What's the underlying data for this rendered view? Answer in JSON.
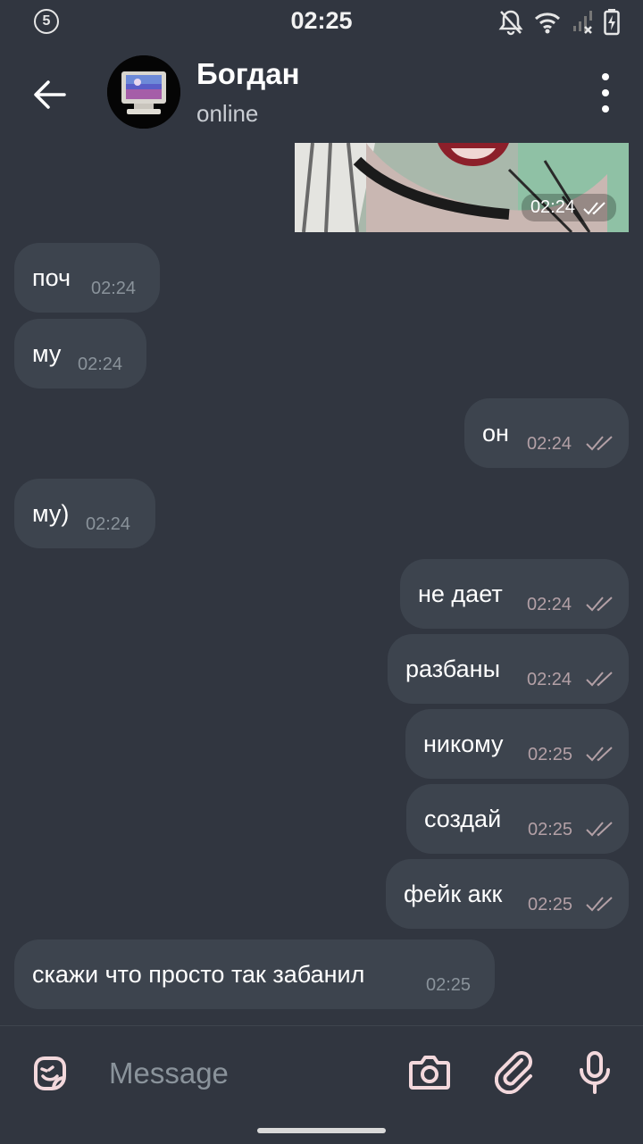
{
  "status_bar": {
    "time": "02:25",
    "notification_count": "5",
    "icons": [
      "notifications-off-icon",
      "wifi-icon",
      "signal-no-service-icon",
      "battery-charging-icon"
    ]
  },
  "header": {
    "contact_name": "Богдан",
    "contact_status": "online",
    "icons": [
      "back-arrow-icon",
      "avatar-retro-computer",
      "more-vert-icon"
    ]
  },
  "messages": [
    {
      "direction": "out",
      "type": "photo",
      "time": "02:24",
      "read": true
    },
    {
      "direction": "in",
      "text": "поч",
      "time": "02:24"
    },
    {
      "direction": "in",
      "text": "му",
      "time": "02:24"
    },
    {
      "direction": "out",
      "text": "он",
      "time": "02:24",
      "read": true
    },
    {
      "direction": "in",
      "text": "му)",
      "time": "02:24"
    },
    {
      "direction": "out",
      "text": "не дает",
      "time": "02:24",
      "read": true
    },
    {
      "direction": "out",
      "text": "разбаны",
      "time": "02:24",
      "read": true
    },
    {
      "direction": "out",
      "text": "никому",
      "time": "02:25",
      "read": true
    },
    {
      "direction": "out",
      "text": "создай",
      "time": "02:25",
      "read": true
    },
    {
      "direction": "out",
      "text": "фейк акк",
      "time": "02:25",
      "read": true
    },
    {
      "direction": "in",
      "text": "скажи что просто так забанил",
      "time": "02:25"
    }
  ],
  "composer": {
    "placeholder": "Message",
    "icons": [
      "sticker-emoji-icon",
      "camera-icon",
      "attach-icon",
      "microphone-icon"
    ]
  },
  "colors": {
    "background": "#313640",
    "bubble": "#3d444e",
    "incoming_time": "#8a939b",
    "outgoing_time": "#b3a0a6",
    "accent_icons": "#f3d8dc"
  }
}
